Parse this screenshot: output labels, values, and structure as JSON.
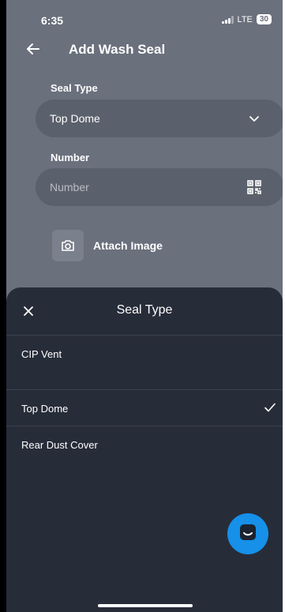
{
  "status": {
    "time": "6:35",
    "network": "LTE",
    "battery": "30"
  },
  "header": {
    "title": "Add Wash Seal"
  },
  "form": {
    "seal_type_label": "Seal Type",
    "seal_type_value": "Top Dome",
    "number_label": "Number",
    "number_placeholder": "Number",
    "attach_label": "Attach Image"
  },
  "sheet": {
    "title": "Seal Type",
    "options": [
      {
        "label": "CIP Vent",
        "selected": false
      },
      {
        "label": "Top Dome",
        "selected": true
      },
      {
        "label": "Rear Dust Cover",
        "selected": false
      }
    ]
  },
  "colors": {
    "background": "#6a707c",
    "field": "#5b616c",
    "sheet": "#272c39",
    "accent": "#1690e8"
  },
  "icons": [
    "back-arrow-icon",
    "chevron-down-icon",
    "qr-code-icon",
    "camera-icon",
    "close-icon",
    "checkmark-icon",
    "chat-icon"
  ]
}
